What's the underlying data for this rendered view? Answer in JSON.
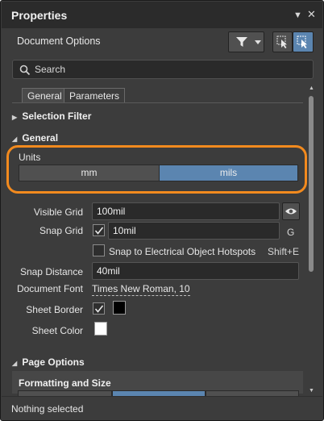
{
  "panel": {
    "title": "Properties",
    "subtitle": "Document Options",
    "search_placeholder": "Search"
  },
  "tabs": [
    {
      "label": "General",
      "active": true
    },
    {
      "label": "Parameters",
      "active": false
    }
  ],
  "sections": {
    "selection_filter": "Selection Filter",
    "general": "General",
    "page_options": "Page Options",
    "formatting_and_size": "Formatting and Size"
  },
  "units": {
    "label": "Units",
    "options": [
      "mm",
      "mils"
    ],
    "selected": "mils"
  },
  "fields": {
    "visible_grid_label": "Visible Grid",
    "visible_grid_value": "100mil",
    "snap_grid_label": "Snap Grid",
    "snap_grid_value": "10mil",
    "snap_grid_shortcut": "G",
    "snap_hotspots_label": "Snap to Electrical Object Hotspots",
    "snap_hotspots_shortcut": "Shift+E",
    "snap_distance_label": "Snap Distance",
    "snap_distance_value": "40mil",
    "document_font_label": "Document Font",
    "document_font_value": "Times New Roman, 10",
    "sheet_border_label": "Sheet Border",
    "sheet_color_label": "Sheet Color"
  },
  "colors": {
    "sheet_border_swatch": "#000000",
    "sheet_color_swatch": "#ffffff",
    "selected_segment": "#5b85b0",
    "highlight_ring": "#f28a1e"
  },
  "status": {
    "text": "Nothing selected"
  }
}
